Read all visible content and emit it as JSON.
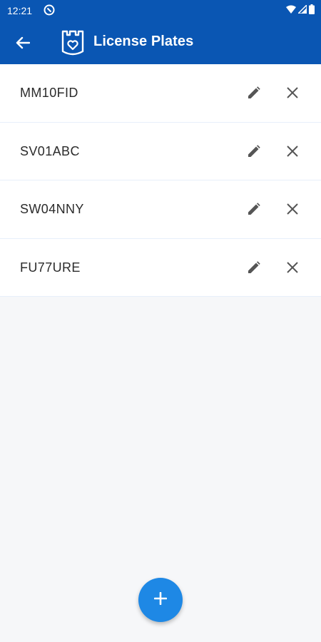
{
  "status_bar": {
    "time": "12:21",
    "icons": [
      "notification-icon",
      "wifi-icon",
      "signal-icon",
      "battery-icon"
    ]
  },
  "app_bar": {
    "title": "License Plates",
    "back_icon": "arrow-left-icon",
    "logo_icon": "castle-heart-logo-icon",
    "color": "#0a56b3"
  },
  "plates": [
    {
      "number": "MM10FID"
    },
    {
      "number": "SV01ABC"
    },
    {
      "number": "SW04NNY"
    },
    {
      "number": "FU77URE"
    }
  ],
  "row_actions": {
    "edit_icon": "pencil-icon",
    "delete_icon": "close-icon"
  },
  "fab": {
    "icon": "plus-icon",
    "color": "#1e88e5"
  }
}
